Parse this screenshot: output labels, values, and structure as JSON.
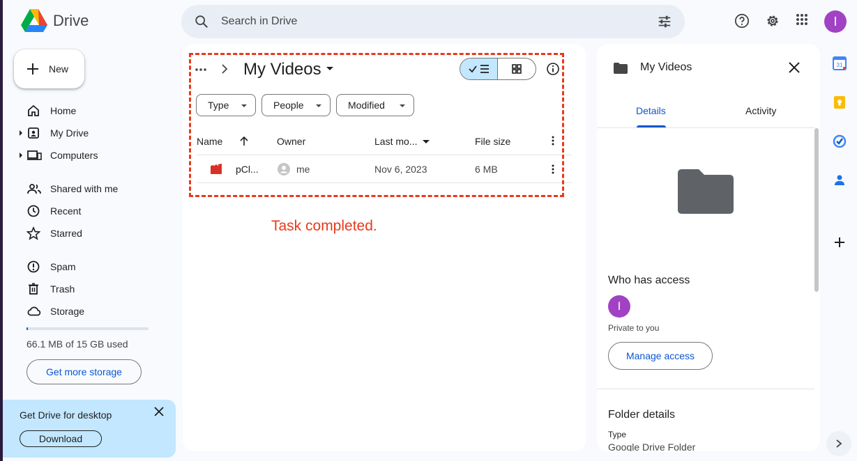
{
  "app": {
    "name": "Drive"
  },
  "search": {
    "placeholder": "Search in Drive"
  },
  "user": {
    "initial": "I",
    "avatar_color": "#a142c4"
  },
  "sidebar": {
    "new_label": "New",
    "items": [
      {
        "label": "Home",
        "icon": "home-icon"
      },
      {
        "label": "My Drive",
        "icon": "my-drive-icon"
      },
      {
        "label": "Computers",
        "icon": "computers-icon"
      },
      {
        "label": "Shared with me",
        "icon": "shared-icon"
      },
      {
        "label": "Recent",
        "icon": "recent-icon"
      },
      {
        "label": "Starred",
        "icon": "star-icon"
      },
      {
        "label": "Spam",
        "icon": "spam-icon"
      },
      {
        "label": "Trash",
        "icon": "trash-icon"
      },
      {
        "label": "Storage",
        "icon": "cloud-icon"
      }
    ],
    "storage_used_fraction": 0.0043,
    "storage_text": "66.1 MB of 15 GB used",
    "more_storage_label": "Get more storage",
    "promo": {
      "title": "Get Drive for desktop",
      "download_label": "Download"
    }
  },
  "main": {
    "breadcrumb_title": "My Videos",
    "filters": [
      "Type",
      "People",
      "Modified"
    ],
    "columns": {
      "name": "Name",
      "owner": "Owner",
      "modified": "Last mo...",
      "size": "File size"
    },
    "rows": [
      {
        "name": "pCl...",
        "owner": "me",
        "modified": "Nov 6, 2023",
        "size": "6 MB"
      }
    ],
    "status_text": "Task completed."
  },
  "details": {
    "title": "My Videos",
    "tabs": [
      "Details",
      "Activity"
    ],
    "who_has_access": "Who has access",
    "private_text": "Private to you",
    "manage_label": "Manage access",
    "folder_details": "Folder details",
    "type_label": "Type",
    "type_value": "Google Drive Folder"
  },
  "colors": {
    "accent": "#0b57d0",
    "status": "#e8391b",
    "selected": "#c2e7ff"
  }
}
